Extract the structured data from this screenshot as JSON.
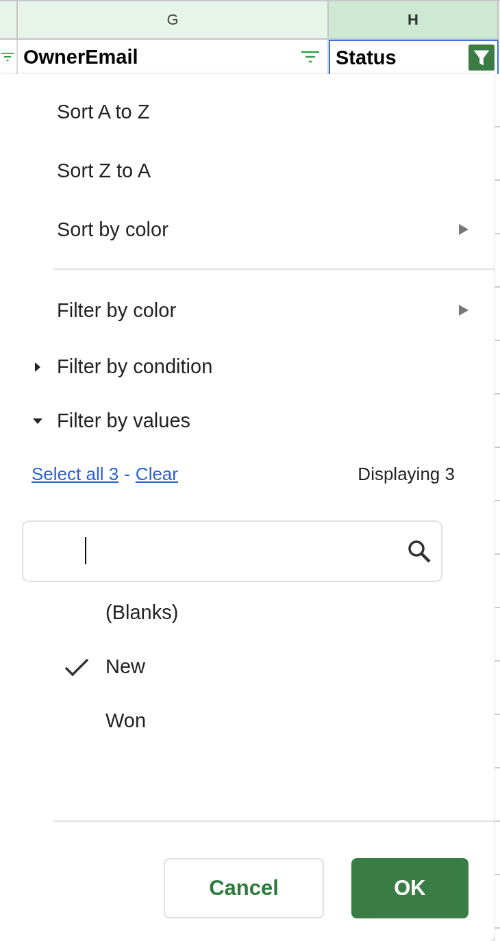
{
  "column_headers": [
    {
      "selected": false
    },
    {
      "letter": "G",
      "selected": false
    },
    {
      "letter": "H",
      "selected": true
    }
  ],
  "header_cells": [
    {
      "filter_active": false
    },
    {
      "text": "OwnerEmail",
      "filter_active": false
    },
    {
      "text": "Status",
      "filter_active": true
    }
  ],
  "menu": {
    "items": [
      {
        "kind": "action",
        "label": "Sort A to Z"
      },
      {
        "kind": "action",
        "label": "Sort Z to A"
      },
      {
        "kind": "submenu",
        "label": "Sort by color"
      },
      {
        "kind": "divider"
      },
      {
        "kind": "submenu",
        "label": "Filter by color"
      },
      {
        "kind": "section",
        "label": "Filter by condition",
        "expanded": false
      },
      {
        "kind": "section",
        "label": "Filter by values",
        "expanded": true
      }
    ],
    "select_all": "Select all 3",
    "separator": "-",
    "clear": "Clear",
    "displaying": "Displaying 3",
    "values": [
      {
        "label": "(Blanks)",
        "checked": false
      },
      {
        "label": "New",
        "checked": true
      },
      {
        "label": "Won",
        "checked": false
      }
    ],
    "buttons": [
      {
        "kind": "secondary",
        "label": "Cancel"
      },
      {
        "kind": "primary",
        "label": "OK"
      }
    ]
  }
}
